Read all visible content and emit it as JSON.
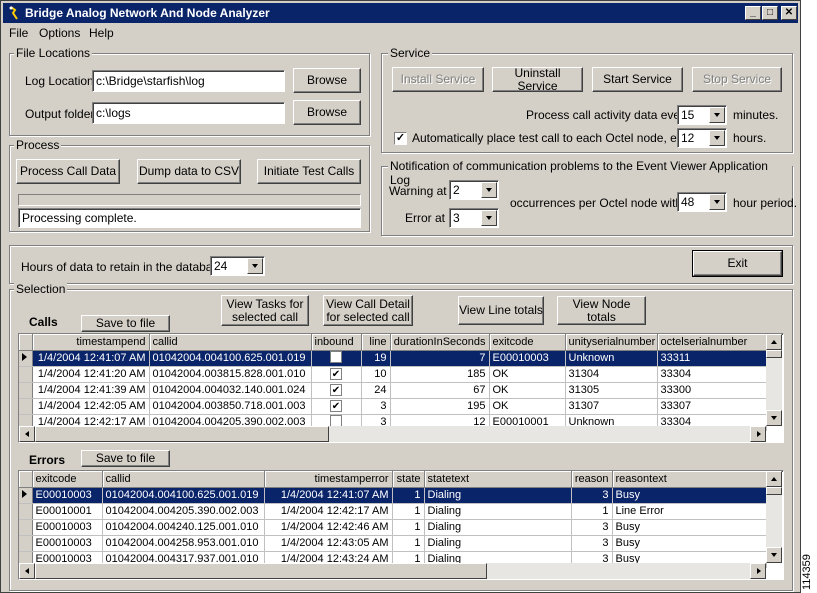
{
  "window": {
    "title": "Bridge Analog Network And Node Analyzer",
    "minimize": "_",
    "maximize": "□",
    "close": "✕"
  },
  "menu": {
    "file": "File",
    "options": "Options",
    "help": "Help"
  },
  "file_locations": {
    "title": "File Locations",
    "log_label": "Log Location:",
    "log_value": "c:\\Bridge\\starfish\\log",
    "output_label": "Output folder:",
    "output_value": "c:\\logs",
    "browse1": "Browse",
    "browse2": "Browse"
  },
  "service": {
    "title": "Service",
    "install": "Install Service",
    "uninstall": "Uninstall Service",
    "start": "Start Service",
    "stop": "Stop Service",
    "process_label": "Process call activity data every",
    "process_value": "15",
    "process_unit": "minutes.",
    "auto_label": "Automatically place test call to each Octel node, every",
    "auto_checked": "✓",
    "auto_value": "12",
    "auto_unit": "hours."
  },
  "process": {
    "title": "Process",
    "process_btn": "Process Call Data",
    "dump_btn": "Dump data to CSV",
    "test_btn": "Initiate Test Calls",
    "status": "Processing complete."
  },
  "notification": {
    "title": "Notification of communication problems to the Event Viewer Application Log",
    "warning_label": "Warning at",
    "warning_value": "2",
    "error_label": "Error at",
    "error_value": "3",
    "occ_label": "occurrences per Octel node within",
    "hours_value": "48",
    "hours_unit": "hour period."
  },
  "retention": {
    "label": "Hours of data to retain in the database:",
    "value": "24",
    "exit": "Exit"
  },
  "selection": {
    "title": "Selection",
    "tasks_btn": "View Tasks for selected call",
    "detail_btn": "View Call Detail for selected call",
    "line_btn": "View Line totals",
    "node_btn": "View Node totals"
  },
  "calls": {
    "label": "Calls",
    "save": "Save to file",
    "columns": [
      "timestampend",
      "callid",
      "inbound",
      "line",
      "durationInSeconds",
      "exitcode",
      "unityserialnumber",
      "octelserialnumber"
    ],
    "rows": [
      [
        "1/4/2004 12:41:07 AM",
        "01042004.004100.625.001.019",
        "",
        "19",
        "7",
        "E00010003",
        "Unknown",
        "33311"
      ],
      [
        "1/4/2004 12:41:20 AM",
        "01042004.003815.828.001.010",
        "✔",
        "10",
        "185",
        "OK",
        "31304",
        "33304"
      ],
      [
        "1/4/2004 12:41:39 AM",
        "01042004.004032.140.001.024",
        "✔",
        "24",
        "67",
        "OK",
        "31305",
        "33300"
      ],
      [
        "1/4/2004 12:42:05 AM",
        "01042004.003850.718.001.003",
        "✔",
        "3",
        "195",
        "OK",
        "31307",
        "33307"
      ],
      [
        "1/4/2004 12:42:17 AM",
        "01042004.004205.390.002.003",
        "",
        "3",
        "12",
        "E00010001",
        "Unknown",
        "33304"
      ]
    ]
  },
  "errors": {
    "label": "Errors",
    "save": "Save to file",
    "columns": [
      "exitcode",
      "callid",
      "timestamperror",
      "state",
      "statetext",
      "reason",
      "reasontext"
    ],
    "rows": [
      [
        "E00010003",
        "01042004.004100.625.001.019",
        "1/4/2004 12:41:07 AM",
        "1",
        "Dialing",
        "3",
        "Busy"
      ],
      [
        "E00010001",
        "01042004.004205.390.002.003",
        "1/4/2004 12:42:17 AM",
        "1",
        "Dialing",
        "1",
        "Line Error"
      ],
      [
        "E00010003",
        "01042004.004240.125.001.010",
        "1/4/2004 12:42:46 AM",
        "1",
        "Dialing",
        "3",
        "Busy"
      ],
      [
        "E00010003",
        "01042004.004258.953.001.010",
        "1/4/2004 12:43:05 AM",
        "1",
        "Dialing",
        "3",
        "Busy"
      ],
      [
        "E00010003",
        "01042004.004317.937.001.010",
        "1/4/2004 12:43:24 AM",
        "1",
        "Dialing",
        "3",
        "Busy"
      ]
    ]
  },
  "figure_id": "114359"
}
